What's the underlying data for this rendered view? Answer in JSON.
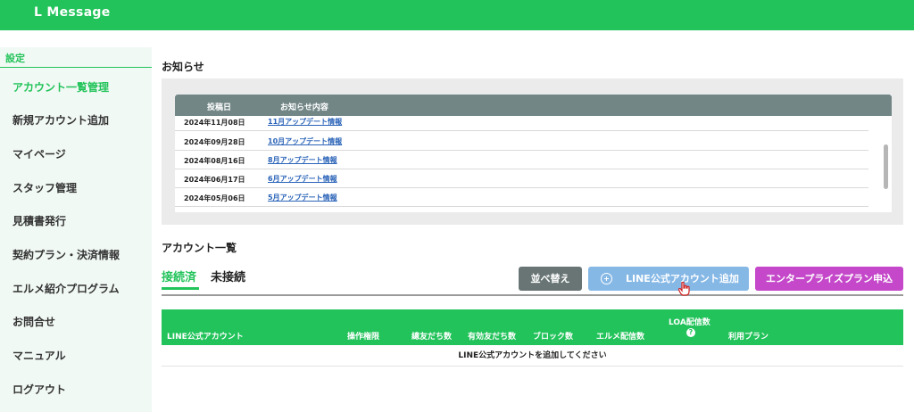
{
  "app": {
    "title": "L Message"
  },
  "sidebar": {
    "section": "設定",
    "items": [
      {
        "label": "アカウント一覧管理",
        "active": true
      },
      {
        "label": "新規アカウント追加"
      },
      {
        "label": "マイページ"
      },
      {
        "label": "スタッフ管理"
      },
      {
        "label": "見積書発行"
      },
      {
        "label": "契約プラン・決済情報"
      },
      {
        "label": "エルメ紹介プログラム"
      },
      {
        "label": "お問合せ"
      },
      {
        "label": "マニュアル"
      },
      {
        "label": "ログアウト"
      }
    ]
  },
  "news": {
    "title": "お知らせ",
    "columns": [
      "投稿日",
      "お知らせ内容"
    ],
    "rows": [
      {
        "date": "2024年11月08日",
        "title": "11月アップデート情報"
      },
      {
        "date": "2024年09月28日",
        "title": "10月アップデート情報"
      },
      {
        "date": "2024年08月16日",
        "title": "8月アップデート情報"
      },
      {
        "date": "2024年06月17日",
        "title": "6月アップデート情報"
      },
      {
        "date": "2024年05月06日",
        "title": "5月アップデート情報"
      }
    ]
  },
  "accounts": {
    "title": "アカウント一覧",
    "tabs": [
      {
        "label": "接続済",
        "active": true
      },
      {
        "label": "未接続"
      }
    ],
    "buttons": {
      "sort": "並べ替え",
      "add": "LINE公式アカウント追加",
      "enterprise": "エンタープライズプラン申込"
    },
    "columns": {
      "account": "LINE公式アカウント",
      "permission": "操作権限",
      "total_friends": "總友だち数",
      "valid_friends": "有効友だち数",
      "blocks": "ブロック数",
      "lme_deliveries": "エルメ配信数",
      "loa_deliveries": "LOA配信数",
      "plan": "利用プラン"
    },
    "empty_message": "LINE公式アカウントを追加してください"
  },
  "colors": {
    "brand": "#22c35a",
    "sort_button": "#697575",
    "add_button": "#86b8e6",
    "enterprise_button": "#c448c9"
  }
}
